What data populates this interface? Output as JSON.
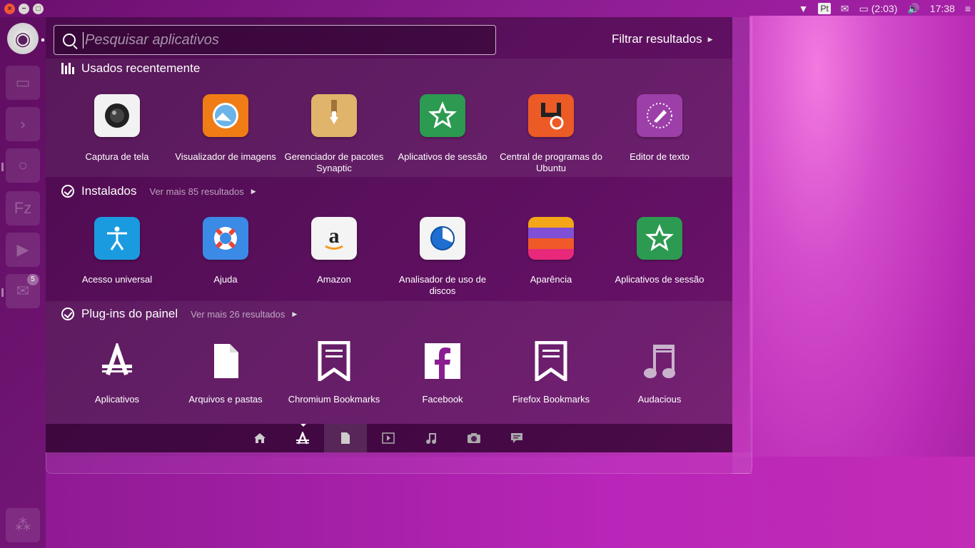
{
  "panel": {
    "keyboard_layout": "Pt",
    "battery": "(2:03)",
    "clock": "17:38"
  },
  "search": {
    "placeholder": "Pesquisar aplicativos",
    "filter_label": "Filtrar resultados"
  },
  "sections": [
    {
      "title": "Usados recentemente",
      "more": "",
      "apps": [
        {
          "label": "Captura de tela",
          "icon": "camera-icon"
        },
        {
          "label": "Visualizador de imagens",
          "icon": "image-viewer-icon"
        },
        {
          "label": "Gerenciador de pacotes Synaptic",
          "icon": "package-icon"
        },
        {
          "label": "Aplicativos de sessão",
          "icon": "star-icon"
        },
        {
          "label": "Central de programas do Ubuntu",
          "icon": "software-center-icon"
        },
        {
          "label": "Editor de texto",
          "icon": "text-editor-icon"
        }
      ]
    },
    {
      "title": "Instalados",
      "more": "Ver mais 85 resultados",
      "apps": [
        {
          "label": "Acesso universal",
          "icon": "accessibility-icon"
        },
        {
          "label": "Ajuda",
          "icon": "lifebuoy-icon"
        },
        {
          "label": "Amazon",
          "icon": "amazon-icon"
        },
        {
          "label": "Analisador de uso de discos",
          "icon": "disk-usage-icon"
        },
        {
          "label": "Aparência",
          "icon": "appearance-icon"
        },
        {
          "label": "Aplicativos de sessão",
          "icon": "star-icon"
        }
      ]
    },
    {
      "title": "Plug-ins do painel",
      "more": "Ver mais 26 resultados",
      "apps": [
        {
          "label": "Aplicativos",
          "icon": "applications-lens-icon"
        },
        {
          "label": "Arquivos e pastas",
          "icon": "file-icon"
        },
        {
          "label": "Chromium Bookmarks",
          "icon": "bookmark-icon"
        },
        {
          "label": "Facebook",
          "icon": "facebook-icon"
        },
        {
          "label": "Firefox Bookmarks",
          "icon": "bookmark-icon"
        },
        {
          "label": "Audacious",
          "icon": "music-note-icon"
        }
      ]
    }
  ],
  "lenses": [
    "home-icon",
    "applications-icon",
    "files-icon",
    "video-icon",
    "music-icon",
    "photo-icon",
    "social-icon"
  ],
  "launcher": {
    "badge": "5"
  },
  "colors": {
    "accent": "#a21fa4",
    "close_button": "#f0563a"
  }
}
